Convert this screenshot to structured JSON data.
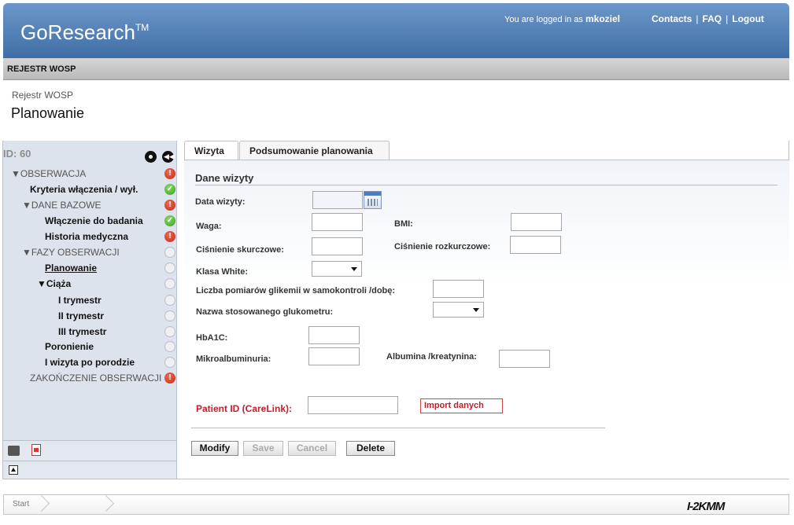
{
  "header": {
    "app_name": "GoResearch",
    "trademark": "TM",
    "logged_in_prefix": "You are logged in as",
    "username": "mkoziel",
    "links": [
      "Contacts",
      "FAQ",
      "Logout"
    ]
  },
  "module": {
    "name": "REJESTR WOSP"
  },
  "breadcrumb": "Rejestr WOSP",
  "page_title": "Planowanie",
  "sidebar": {
    "id_label": "ID: 60",
    "tree": [
      {
        "label": "▼OBSERWACJA",
        "status": "error"
      },
      {
        "label": "Kryteria włączenia / wył.",
        "status": "ok"
      },
      {
        "label": "▼DANE BAZOWE",
        "status": "error"
      },
      {
        "label": "Włączenie do badania",
        "status": "ok"
      },
      {
        "label": "Historia medyczna",
        "status": "error"
      },
      {
        "label": "▼FAZY OBSERWACJI",
        "status": "empty"
      },
      {
        "label": "Planowanie",
        "status": "empty"
      },
      {
        "label": "▼Ciąża",
        "status": "empty"
      },
      {
        "label": "I trymestr",
        "status": "empty"
      },
      {
        "label": "II trymestr",
        "status": "empty"
      },
      {
        "label": "III trymestr",
        "status": "empty"
      },
      {
        "label": "Poronienie",
        "status": "empty"
      },
      {
        "label": "I wizyta po porodzie",
        "status": "empty"
      },
      {
        "label": "ZAKOŃCZENIE OBSERWACJI",
        "status": "error"
      }
    ]
  },
  "tabs": [
    "Wizyta",
    "Podsumowanie planowania"
  ],
  "form": {
    "section_title": "Dane wizyty",
    "fields": {
      "data_wizyty": "Data wizyty:",
      "waga": "Waga:",
      "bmi": "BMI:",
      "cisnienie_skurczowe": "Ciśnienie skurczowe:",
      "cisnienie_rozkurczowe": "Ciśnienie rozkurczowe:",
      "klasa_white": "Klasa White:",
      "liczba_pomiarow": "Liczba pomiarów glikemii w samokontroli /dobę:",
      "nazwa_glukometru": "Nazwa stosowanego glukometru:",
      "hba1c": "HbA1C:",
      "mikroalbuminuria": "Mikroalbuminuria:",
      "albumina": "Albumina /kreatynina:",
      "patient_id": "Patient ID (CareLink):"
    },
    "import_label": "Import danych",
    "buttons": [
      "Modify",
      "Save",
      "Cancel",
      "Delete"
    ]
  },
  "footer": {
    "start": "Start",
    "logo": "I-2KMM"
  }
}
